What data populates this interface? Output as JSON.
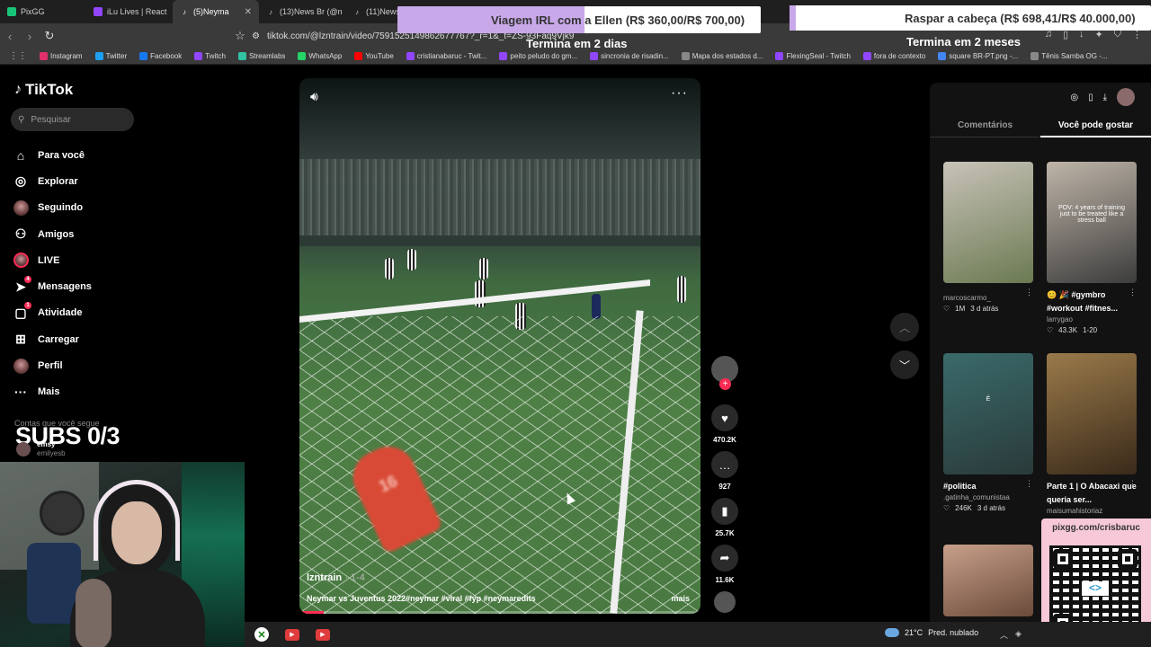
{
  "tabs": [
    {
      "label": "PixGG",
      "icon": "pixgg-icon",
      "color": "#18c47a"
    },
    {
      "label": "iLu Lives | React",
      "icon": "twitch-icon",
      "color": "#9146ff"
    },
    {
      "label": "(5)Neyma",
      "icon": "tiktok-icon",
      "color": "#ffffff",
      "active": true
    },
    {
      "label": "(13)News Br (@n",
      "icon": "tiktok-icon",
      "color": "#ffffff"
    },
    {
      "label": "(11)News",
      "icon": "tiktok-icon",
      "color": "#ffffff"
    }
  ],
  "address": {
    "url": "tiktok.com/@lzntrain/video/7591525149862677767?_r=1&_t=ZS-93Faq9Vjk9"
  },
  "bookmarks": [
    "Instagram",
    "Twitter",
    "Facebook",
    "Twitch",
    "Streamlabs",
    "WhatsApp",
    "YouTube",
    "cristianabaruc - Twit...",
    "peito peludo do gm...",
    "sincronia de risadin...",
    "Mapa dos estados d...",
    "FlexingSeal - Twitch",
    "fora de contexto",
    "square BR-PT.png -...",
    "Tênis Samba OG -..."
  ],
  "bookmark_colors": [
    "#e1306c",
    "#1da1f2",
    "#1877f2",
    "#9146ff",
    "#31c3a2",
    "#25d366",
    "#ff0000",
    "#9146ff",
    "#9146ff",
    "#9146ff",
    "#888888",
    "#9146ff",
    "#9146ff",
    "#4285f4",
    "#888888"
  ],
  "sidebar": {
    "logo": "TikTok",
    "search_placeholder": "Pesquisar",
    "items": [
      {
        "label": "Para você",
        "icon": "home-icon",
        "glyph": "⌂"
      },
      {
        "label": "Explorar",
        "icon": "compass-icon",
        "glyph": "◎"
      },
      {
        "label": "Seguindo",
        "icon": "avatar-icon",
        "glyph": ""
      },
      {
        "label": "Amigos",
        "icon": "friends-icon",
        "glyph": "⚇"
      },
      {
        "label": "LIVE",
        "icon": "live-icon",
        "glyph": ""
      },
      {
        "label": "Mensagens",
        "icon": "send-icon",
        "glyph": "➤",
        "badge": "4"
      },
      {
        "label": "Atividade",
        "icon": "inbox-icon",
        "glyph": "▢",
        "badge": "1"
      },
      {
        "label": "Carregar",
        "icon": "plus-square-icon",
        "glyph": "⊞"
      },
      {
        "label": "Perfil",
        "icon": "profile-icon",
        "glyph": ""
      },
      {
        "label": "Mais",
        "icon": "more-icon",
        "glyph": "···"
      }
    ],
    "following_label": "Contas que você segue",
    "account": {
      "name": "emsy",
      "handle": "emilyesb"
    }
  },
  "stream_overlay": {
    "subs": "SUBS 0/3",
    "goal1": {
      "label": "Viagem IRL com a Ellen",
      "amount": "(R$ 360,00/R$ 700,00)",
      "sub": "Termina em 2 dias",
      "progress": 0.514
    },
    "goal2": {
      "label": "Raspar a cabeça",
      "amount": "(R$ 698,41/R$ 40.000,00)",
      "sub": "Termina em 2 meses",
      "progress": 0.017
    },
    "qr_url": "pixgg.com/crisbaruc"
  },
  "video": {
    "author": "lzntrain",
    "date": "1-4",
    "caption": "Neymar vs Juventus 2022#neymar #viral #fyp #neymaredits",
    "more": "mais",
    "progress": 0.06,
    "jersey": "16"
  },
  "actions": {
    "likes": "470.2K",
    "comments": "927",
    "saves": "25.7K",
    "shares": "11.6K"
  },
  "right_panel": {
    "tabs": [
      "Comentários",
      "Você pode gostar"
    ],
    "cards": [
      {
        "title": "",
        "author": "marcoscarmo_",
        "likes": "1M",
        "time": "3 d atrás",
        "colors": [
          "#c8c2b8",
          "#6b7a52"
        ]
      },
      {
        "title": "😊 🎉 #gymbro #workout #fitnes...",
        "author": "larrygao",
        "likes": "43.3K",
        "time": "1-20",
        "colors": [
          "#bfb5a8",
          "#3c3c3c"
        ],
        "overlay": "POV: 4 years of training just to be treated like a stress ball"
      },
      {
        "title": "#politica",
        "author": ".gatinha_comunistaa",
        "likes": "246K",
        "time": "3 d atrás",
        "colors": [
          "#3a6a6a",
          "#2a3a3a"
        ],
        "overlay": "É"
      },
      {
        "title": "Parte 1 | O Abacaxi que queria ser...",
        "author": "maisumahistoriaz",
        "likes": "",
        "time": "",
        "colors": [
          "#9a7a4a",
          "#3a2a1a"
        ]
      },
      {
        "title": "",
        "author": "",
        "likes": "",
        "time": "",
        "colors": [
          "#c8a08a",
          "#6a4a3a"
        ]
      }
    ]
  },
  "taskbar": {
    "temp": "21°C",
    "weather": "Pred. nublado"
  }
}
